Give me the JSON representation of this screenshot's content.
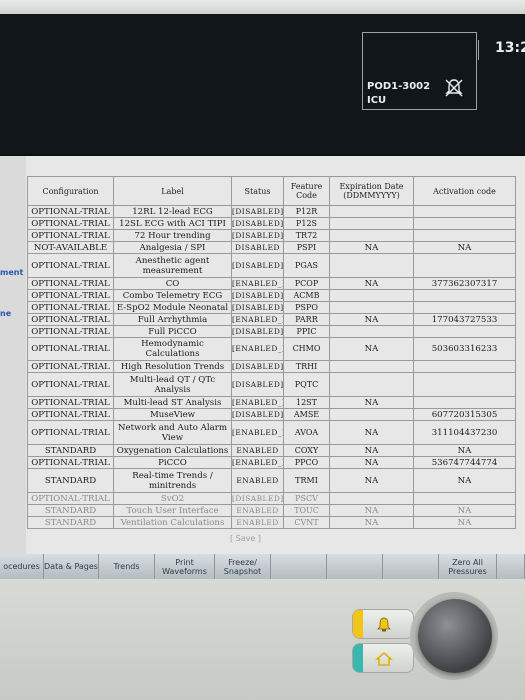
{
  "header": {
    "bed": "POD1-3002",
    "unit": "ICU",
    "clock": "13:2",
    "no_alarm_icon": "bell-crossed-icon"
  },
  "sidebar": {
    "items": [
      "ment",
      "ne"
    ]
  },
  "table": {
    "columns": [
      "Configuration",
      "Label",
      "Status",
      "Feature Code",
      "Expiration Date (DDMMYYYY)",
      "Activation code"
    ],
    "rows": [
      {
        "config": "OPTIONAL-TRIAL",
        "label": "12RL 12-lead ECG",
        "status": "[DISABLED]",
        "code": "P12R",
        "exp": "",
        "act": ""
      },
      {
        "config": "OPTIONAL-TRIAL",
        "label": "12SL ECG with ACI TIPI",
        "status": "[DISABLED]",
        "code": "P12S",
        "exp": "",
        "act": ""
      },
      {
        "config": "OPTIONAL-TRIAL",
        "label": "72 Hour trending",
        "status": "[DISABLED]",
        "code": "TR72",
        "exp": "",
        "act": ""
      },
      {
        "config": "NOT-AVAILABLE",
        "label": "Analgesia / SPI",
        "status": "DISABLED",
        "code": "PSPI",
        "exp": "NA",
        "act": "NA"
      },
      {
        "config": "OPTIONAL-TRIAL",
        "label": "Anesthetic agent measurement",
        "status": "[DISABLED]",
        "code": "PGAS",
        "exp": "",
        "act": ""
      },
      {
        "config": "OPTIONAL-TRIAL",
        "label": "CO",
        "status": "[ENABLED_]",
        "code": "PCOP",
        "exp": "NA",
        "act": "377362307317"
      },
      {
        "config": "OPTIONAL-TRIAL",
        "label": "Combo Telemetry ECG",
        "status": "[DISABLED]",
        "code": "ACMB",
        "exp": "",
        "act": ""
      },
      {
        "config": "OPTIONAL-TRIAL",
        "label": "E-SpO2 Module Neonatal",
        "status": "[DISABLED]",
        "code": "PSPO",
        "exp": "",
        "act": ""
      },
      {
        "config": "OPTIONAL-TRIAL",
        "label": "Full Arrhythmia",
        "status": "[ENABLED_]",
        "code": "PARR",
        "exp": "NA",
        "act": "177043727533"
      },
      {
        "config": "OPTIONAL-TRIAL",
        "label": "Full PiCCO",
        "status": "[DISABLED]",
        "code": "PPIC",
        "exp": "",
        "act": ""
      },
      {
        "config": "OPTIONAL-TRIAL",
        "label": "Hemodynamic Calculations",
        "status": "[ENABLED_]",
        "code": "CHMO",
        "exp": "NA",
        "act": "503603316233"
      },
      {
        "config": "OPTIONAL-TRIAL",
        "label": "High Resolution Trends",
        "status": "[DISABLED]",
        "code": "TRHI",
        "exp": "",
        "act": ""
      },
      {
        "config": "OPTIONAL-TRIAL",
        "label": "Multi-lead QT / QTc Analysis",
        "status": "[DISABLED]",
        "code": "PQTC",
        "exp": "",
        "act": ""
      },
      {
        "config": "OPTIONAL-TRIAL",
        "label": "Multi-lead ST Analysis",
        "status": "[ENABLED_]",
        "code": "12ST",
        "exp": "NA",
        "act": ""
      },
      {
        "config": "OPTIONAL-TRIAL",
        "label": "MuseView",
        "status": "[DISABLED]",
        "code": "AMSE",
        "exp": "",
        "act": "607720315305"
      },
      {
        "config": "OPTIONAL-TRIAL",
        "label": "Network and Auto Alarm View",
        "status": "[ENABLED_]",
        "code": "AVOA",
        "exp": "NA",
        "act": "311104437230"
      },
      {
        "config": "STANDARD",
        "label": "Oxygenation Calculations",
        "status": "ENABLED",
        "code": "COXY",
        "exp": "NA",
        "act": "NA"
      },
      {
        "config": "OPTIONAL-TRIAL",
        "label": "PiCCO",
        "status": "[ENABLED_]",
        "code": "PPCO",
        "exp": "NA",
        "act": "536747744774"
      },
      {
        "config": "STANDARD",
        "label": "Real-time Trends / minitrends",
        "status": "ENABLED",
        "code": "TRMI",
        "exp": "NA",
        "act": "NA"
      },
      {
        "config": "OPTIONAL-TRIAL",
        "label": "SvO2",
        "status": "[DISABLED]",
        "code": "PSCV",
        "exp": "",
        "act": ""
      },
      {
        "config": "STANDARD",
        "label": "Touch User Interface",
        "status": "ENABLED",
        "code": "TOUC",
        "exp": "NA",
        "act": "NA"
      },
      {
        "config": "STANDARD",
        "label": "Ventilation Calculations",
        "status": "ENABLED",
        "code": "CVNT",
        "exp": "NA",
        "act": "NA"
      }
    ]
  },
  "save_label": "[ Save ]",
  "softkeys": [
    {
      "label": "ocedures",
      "enabled": true
    },
    {
      "label": "Data & Pages",
      "enabled": true
    },
    {
      "label": "Trends",
      "enabled": true
    },
    {
      "label": "Print Waveforms",
      "enabled": true
    },
    {
      "label": "Freeze/ Snapshot",
      "enabled": true
    },
    {
      "label": "",
      "enabled": false
    },
    {
      "label": "",
      "enabled": false
    },
    {
      "label": "",
      "enabled": false
    },
    {
      "label": "Zero All Pressures",
      "enabled": true
    },
    {
      "label": "",
      "enabled": false
    }
  ],
  "colors": {
    "alarm_strip": "#f0c419",
    "home_strip": "#39b7ae",
    "link_blue": "#2a55b0"
  }
}
